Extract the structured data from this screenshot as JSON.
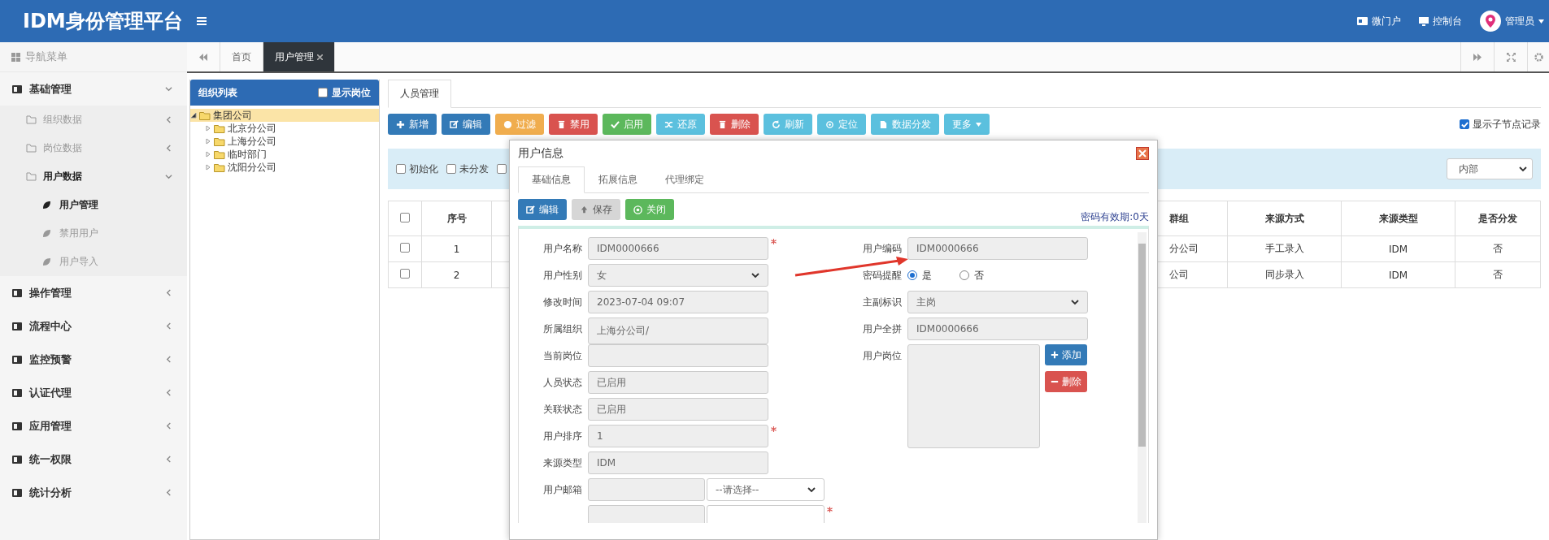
{
  "header": {
    "title": "IDM身份管理平台",
    "links": [
      {
        "label": "微门户"
      },
      {
        "label": "控制台"
      }
    ],
    "user": "管理员"
  },
  "sidebar": {
    "title": "导航菜单",
    "items": [
      {
        "label": "基础管理",
        "expanded": true,
        "children": [
          {
            "label": "组织数据",
            "expanded": false
          },
          {
            "label": "岗位数据",
            "expanded": false
          },
          {
            "label": "用户数据",
            "expanded": true,
            "children": [
              {
                "label": "用户管理",
                "selected": true
              },
              {
                "label": "禁用用户",
                "selected": false
              },
              {
                "label": "用户导入",
                "selected": false
              }
            ]
          }
        ]
      },
      {
        "label": "操作管理",
        "expanded": false
      },
      {
        "label": "流程中心",
        "expanded": false
      },
      {
        "label": "监控预警",
        "expanded": false
      },
      {
        "label": "认证代理",
        "expanded": false
      },
      {
        "label": "应用管理",
        "expanded": false
      },
      {
        "label": "统一权限",
        "expanded": false
      },
      {
        "label": "统计分析",
        "expanded": false
      }
    ]
  },
  "page_tabs": [
    {
      "label": "首页",
      "selected": false,
      "closable": false
    },
    {
      "label": "用户管理",
      "selected": true,
      "closable": true
    }
  ],
  "org_panel": {
    "title": "组织列表",
    "show_positions": {
      "label": "显示岗位",
      "checked": false
    },
    "tree": [
      {
        "label": "集团公司",
        "expanded": true,
        "selected": true,
        "children": [
          {
            "label": "北京分公司",
            "expanded": false,
            "selected": false
          },
          {
            "label": "上海分公司",
            "expanded": false,
            "selected": false
          },
          {
            "label": "临时部门",
            "expanded": false,
            "selected": false
          },
          {
            "label": "沈阳分公司",
            "expanded": false,
            "selected": false
          }
        ]
      }
    ]
  },
  "main": {
    "tabs": [
      {
        "label": "人员管理",
        "selected": true
      }
    ],
    "toolbar": [
      {
        "label": "新增",
        "kind": "primary"
      },
      {
        "label": "编辑",
        "kind": "primary"
      },
      {
        "label": "过滤",
        "kind": "warning"
      },
      {
        "label": "禁用",
        "kind": "danger"
      },
      {
        "label": "启用",
        "kind": "success"
      },
      {
        "label": "还原",
        "kind": "info"
      },
      {
        "label": "删除",
        "kind": "danger"
      },
      {
        "label": "刷新",
        "kind": "info"
      },
      {
        "label": "定位",
        "kind": "info"
      },
      {
        "label": "数据分发",
        "kind": "info"
      },
      {
        "label": "更多",
        "kind": "info",
        "dropdown": true
      }
    ],
    "show_child_records": {
      "label": "显示子节点记录",
      "checked": true
    },
    "filters": [
      {
        "label": "初始化",
        "checked": false
      },
      {
        "label": "未分发",
        "checked": false
      },
      {
        "checked": false
      }
    ],
    "scope_select": "内部",
    "table": {
      "header_checkbox": {
        "checked": false
      },
      "columns": [
        "序号",
        "群组",
        "来源方式",
        "来源类型",
        "是否分发"
      ],
      "rows": [
        {
          "selected": false,
          "cells": [
            "1",
            "分公司",
            "手工录入",
            "IDM",
            "否"
          ]
        },
        {
          "selected": false,
          "cells": [
            "2",
            "公司",
            "同步录入",
            "IDM",
            "否"
          ]
        }
      ]
    }
  },
  "dialog": {
    "title": "用户信息",
    "tabs": [
      {
        "label": "基础信息",
        "selected": true
      },
      {
        "label": "拓展信息",
        "selected": false
      },
      {
        "label": "代理绑定",
        "selected": false
      }
    ],
    "buttons": [
      {
        "label": "编辑",
        "kind": "primary",
        "disabled": false
      },
      {
        "label": "保存",
        "kind": "default",
        "disabled": true
      },
      {
        "label": "关闭",
        "kind": "success",
        "disabled": false
      }
    ],
    "password_expiry": "密码有效期:0天",
    "left_fields": [
      {
        "label": "用户名称",
        "kind": "text",
        "value": "IDM0000666",
        "required": true
      },
      {
        "label": "用户性别",
        "kind": "select",
        "value": "女",
        "required": false
      },
      {
        "label": "修改时间",
        "kind": "text",
        "value": "2023-07-04 09:07",
        "required": false
      },
      {
        "label": "所属组织",
        "kind": "textarea",
        "value": "上海分公司/",
        "required": false
      },
      {
        "label": "当前岗位",
        "kind": "text",
        "required": false
      },
      {
        "label": "人员状态",
        "kind": "text",
        "value": "已启用",
        "required": false
      },
      {
        "label": "关联状态",
        "kind": "text",
        "value": "已启用",
        "required": false
      },
      {
        "label": "用户排序",
        "kind": "text",
        "value": "1",
        "required": true
      },
      {
        "label": "来源类型",
        "kind": "text",
        "value": "IDM",
        "required": false
      },
      {
        "label": "用户邮箱",
        "kind": "pair",
        "select": "--请选择--",
        "required": false
      },
      {
        "kind": "pair",
        "required": true
      }
    ],
    "right_fields": [
      {
        "label": "用户编码",
        "kind": "text",
        "value": "IDM0000666"
      },
      {
        "label": "密码提醒",
        "kind": "radio",
        "options": [
          {
            "label": "是",
            "selected": true
          },
          {
            "label": "否",
            "selected": false
          }
        ]
      },
      {
        "label": "主副标识",
        "kind": "select",
        "value": "主岗"
      },
      {
        "label": "用户全拼",
        "kind": "text",
        "value": "IDM0000666"
      },
      {
        "label": "用户岗位",
        "kind": "list",
        "buttons": [
          {
            "label": "添加",
            "kind": "primary"
          },
          {
            "label": "删除",
            "kind": "danger"
          }
        ]
      }
    ]
  }
}
